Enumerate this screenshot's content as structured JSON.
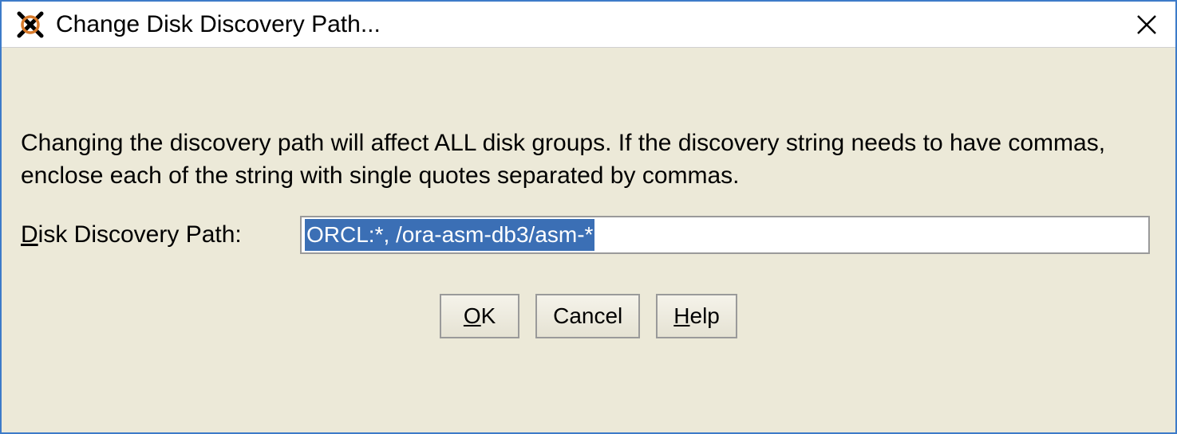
{
  "window": {
    "title": "Change Disk Discovery Path..."
  },
  "content": {
    "description": "Changing the discovery path will affect ALL disk groups. If the discovery string needs to have commas, enclose each of the string with single quotes separated by commas.",
    "input_label_prefix": "D",
    "input_label_rest": "isk Discovery Path:",
    "input_value": "ORCL:*, /ora-asm-db3/asm-*"
  },
  "buttons": {
    "ok_u": "O",
    "ok_rest": "K",
    "cancel": "Cancel",
    "help_u": "H",
    "help_rest": "elp"
  }
}
